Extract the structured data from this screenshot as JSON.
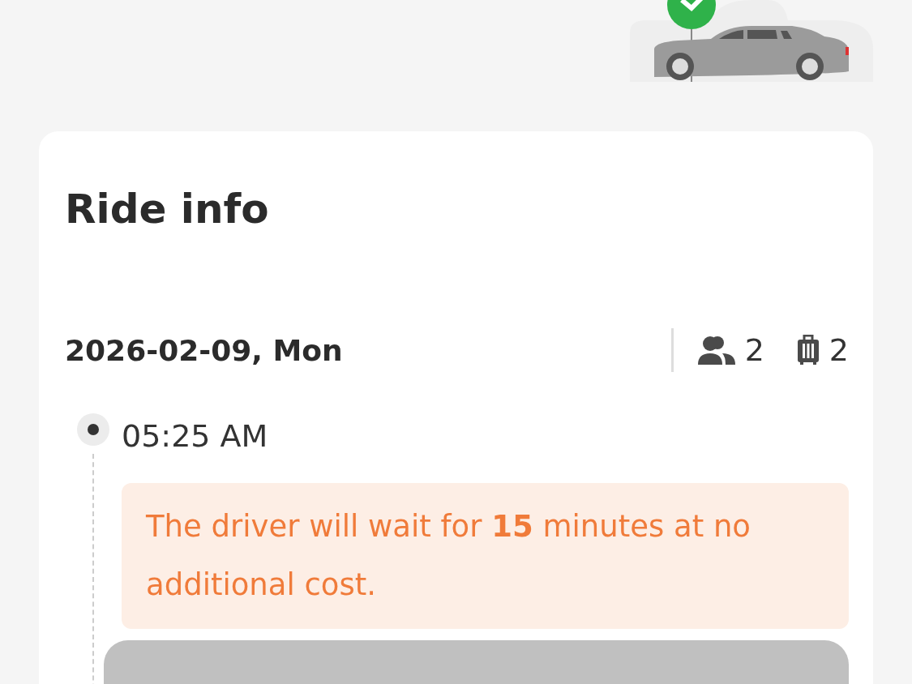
{
  "card": {
    "title": "Ride info",
    "date": "2026-02-09, Mon",
    "passengers": "2",
    "luggage": "2",
    "stops": [
      {
        "time": "05:25 AM",
        "notice": "The driver will wait for **15** minutes at no additional cost."
      }
    ]
  }
}
